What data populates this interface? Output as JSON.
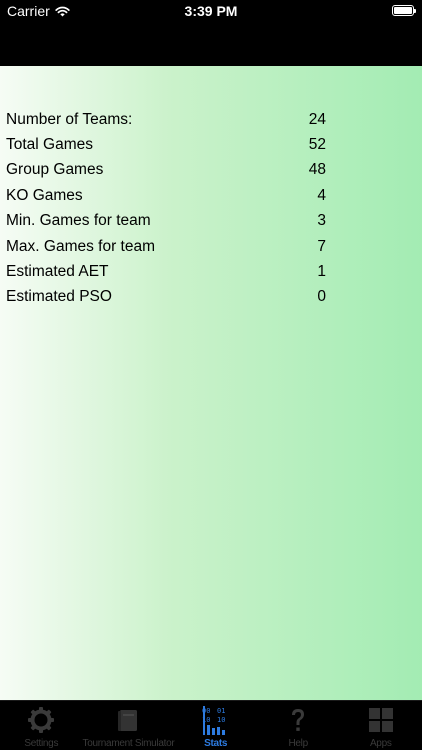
{
  "status_bar": {
    "carrier": "Carrier",
    "time": "3:39 PM"
  },
  "stats": [
    {
      "label": "Number of Teams:",
      "value": "24"
    },
    {
      "label": "Total Games",
      "value": "52"
    },
    {
      "label": "Group Games",
      "value": "48"
    },
    {
      "label": "KO Games",
      "value": "4"
    },
    {
      "label": "Min. Games for team",
      "value": "3"
    },
    {
      "label": "Max. Games for team",
      "value": "7"
    },
    {
      "label": "Estimated AET",
      "value": "1"
    },
    {
      "label": "Estimated PSO",
      "value": "0"
    }
  ],
  "tab_bar": {
    "tabs": [
      {
        "label": "Settings",
        "icon": "gear-icon",
        "active": false
      },
      {
        "label": "Tournament Simulator",
        "icon": "book-icon",
        "active": false
      },
      {
        "label": "Stats",
        "icon": "stats-icon",
        "active": true
      },
      {
        "label": "Help",
        "icon": "question-icon",
        "active": false
      },
      {
        "label": "Apps",
        "icon": "apps-grid-icon",
        "active": false
      }
    ],
    "active_color": "#2d7be0",
    "inactive_color": "#3a3a3a"
  }
}
